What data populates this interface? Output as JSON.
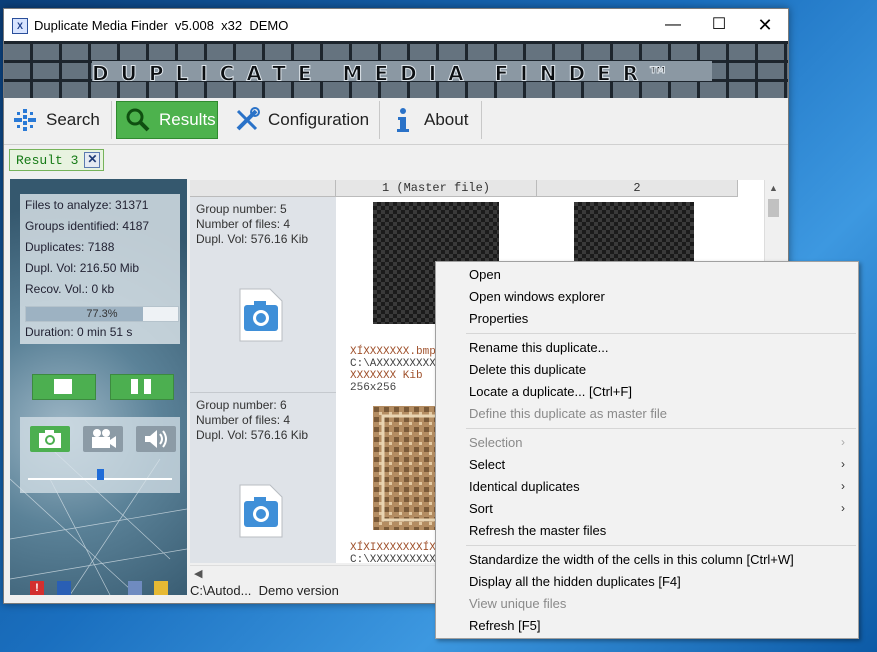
{
  "window": {
    "app_icon": "X",
    "title": "Duplicate Media Finder  v5.008  x32  DEMO",
    "min_glyph": "—",
    "max_glyph": "☐",
    "close_glyph": "✕"
  },
  "banner": {
    "text": "DUPLICATE MEDIA FINDER",
    "tm": "TM"
  },
  "toolbar": {
    "search": "Search",
    "results": "Results",
    "configuration": "Configuration",
    "about": "About"
  },
  "result_tab": {
    "label": "Result 3",
    "close": "✕"
  },
  "stats": {
    "files_to_analyze": "Files to analyze: 31371",
    "groups_identified": "Groups identified: 4187",
    "duplicates": "Duplicates: 7188",
    "dupl_vol": "Dupl. Vol: 216.50 Mib",
    "recov_vol": "Recov. Vol.: 0 kb",
    "progress_text": "77.3%",
    "progress_fraction": 0.773,
    "duration": "Duration: 0 min  51 s"
  },
  "grid": {
    "col1": "1 (Master file)",
    "col2": "2",
    "groups": [
      {
        "number": "Group number: 5",
        "files": "Number of files: 4",
        "vol": "Dupl. Vol: 576.16 Kib",
        "info1": "XÍXXXXXXX.bmp",
        "info2": "C:\\AXXXXXXXXX\\XXX",
        "info3": "XXXXXXX Kib",
        "info4": "256x256"
      },
      {
        "number": "Group number: 6",
        "files": "Number of files: 4",
        "vol": "Dupl. Vol: 576.16 Kib",
        "info1": "XÍXIXXXXXXXÍXIXX",
        "info2": "C:\\XXXXXXXXXXXXXX"
      }
    ]
  },
  "statusbar": {
    "text": "C:\\Autod...  Demo version"
  },
  "context_menu": {
    "open": "Open",
    "open_explorer": "Open windows explorer",
    "properties": "Properties",
    "rename": "Rename this duplicate...",
    "delete": "Delete this duplicate",
    "locate": "Locate a duplicate...   [Ctrl+F]",
    "define_master": "Define this duplicate as master file",
    "selection": "Selection",
    "select": "Select",
    "identical": "Identical duplicates",
    "sort": "Sort",
    "refresh_master": "Refresh the master files",
    "standardize": "Standardize the width of the cells in this column   [Ctrl+W]",
    "display_hidden": "Display all the hidden duplicates   [F4]",
    "view_unique": "View unique files",
    "refresh": "Refresh   [F5]",
    "submenu_arrow": "›"
  },
  "colors": {
    "results_green": "#4db24d",
    "tab_green_text": "#157a15",
    "slider_thumb": "#1f6cd8"
  }
}
